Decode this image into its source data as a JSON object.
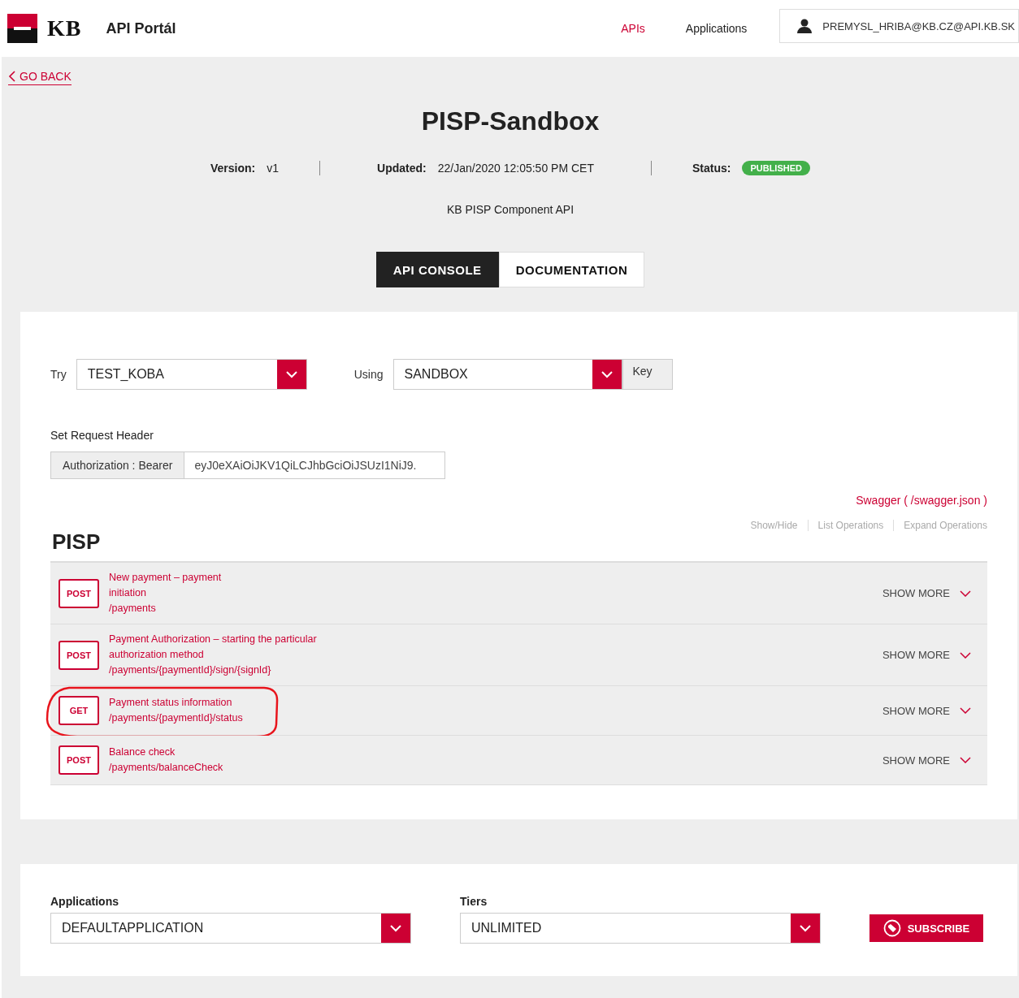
{
  "header": {
    "brand": "KB",
    "title": "API Portál",
    "nav": [
      {
        "label": "APIs",
        "selected": true
      },
      {
        "label": "Applications",
        "selected": false
      }
    ],
    "user": "PREMYSL_HRIBA@KB.CZ@API.KB.SK"
  },
  "back": "GO BACK",
  "api": {
    "name": "PISP-Sandbox",
    "version_label": "Version:",
    "version": "v1",
    "updated_label": "Updated:",
    "updated": "22/Jan/2020 12:05:50 PM CET",
    "status_label": "Status:",
    "status": "PUBLISHED",
    "description": "KB PISP Component API"
  },
  "tabs": [
    {
      "label": "API CONSOLE",
      "selected": true
    },
    {
      "label": "DOCUMENTATION",
      "selected": false
    }
  ],
  "console": {
    "try_label": "Try",
    "try_value": "TEST_KOBA",
    "using_label": "Using",
    "using_value": "SANDBOX",
    "key_button": "Key",
    "header_label": "Set Request Header",
    "auth_label": "Authorization : Bearer",
    "auth_value": "eyJ0eXAiOiJKV1QiLCJhbGciOiJSUzI1NiJ9.",
    "swagger": "Swagger ( /swagger.json )",
    "section": "PISP",
    "actions": [
      "Show/Hide",
      "List Operations",
      "Expand Operations"
    ],
    "operations": [
      {
        "method": "POST",
        "title_lines": [
          "New payment – payment",
          "initiation"
        ],
        "path": "/payments",
        "more": "SHOW MORE",
        "highlighted": false
      },
      {
        "method": "POST",
        "title_lines": [
          "Payment Authorization – starting the particular",
          "authorization method"
        ],
        "path": "/payments/{paymentId}/sign/{signId}",
        "more": "SHOW MORE",
        "highlighted": false
      },
      {
        "method": "GET",
        "title_lines": [
          "Payment status information"
        ],
        "path": "/payments/{paymentId}/status",
        "more": "SHOW MORE",
        "highlighted": true
      },
      {
        "method": "POST",
        "title_lines": [
          "Balance check"
        ],
        "path": "/payments/balanceCheck",
        "more": "SHOW MORE",
        "highlighted": false
      }
    ]
  },
  "subscription": {
    "applications_label": "Applications",
    "application": "DEFAULTAPPLICATION",
    "tiers_label": "Tiers",
    "tier": "UNLIMITED",
    "subscribe": "SUBSCRIBE"
  }
}
